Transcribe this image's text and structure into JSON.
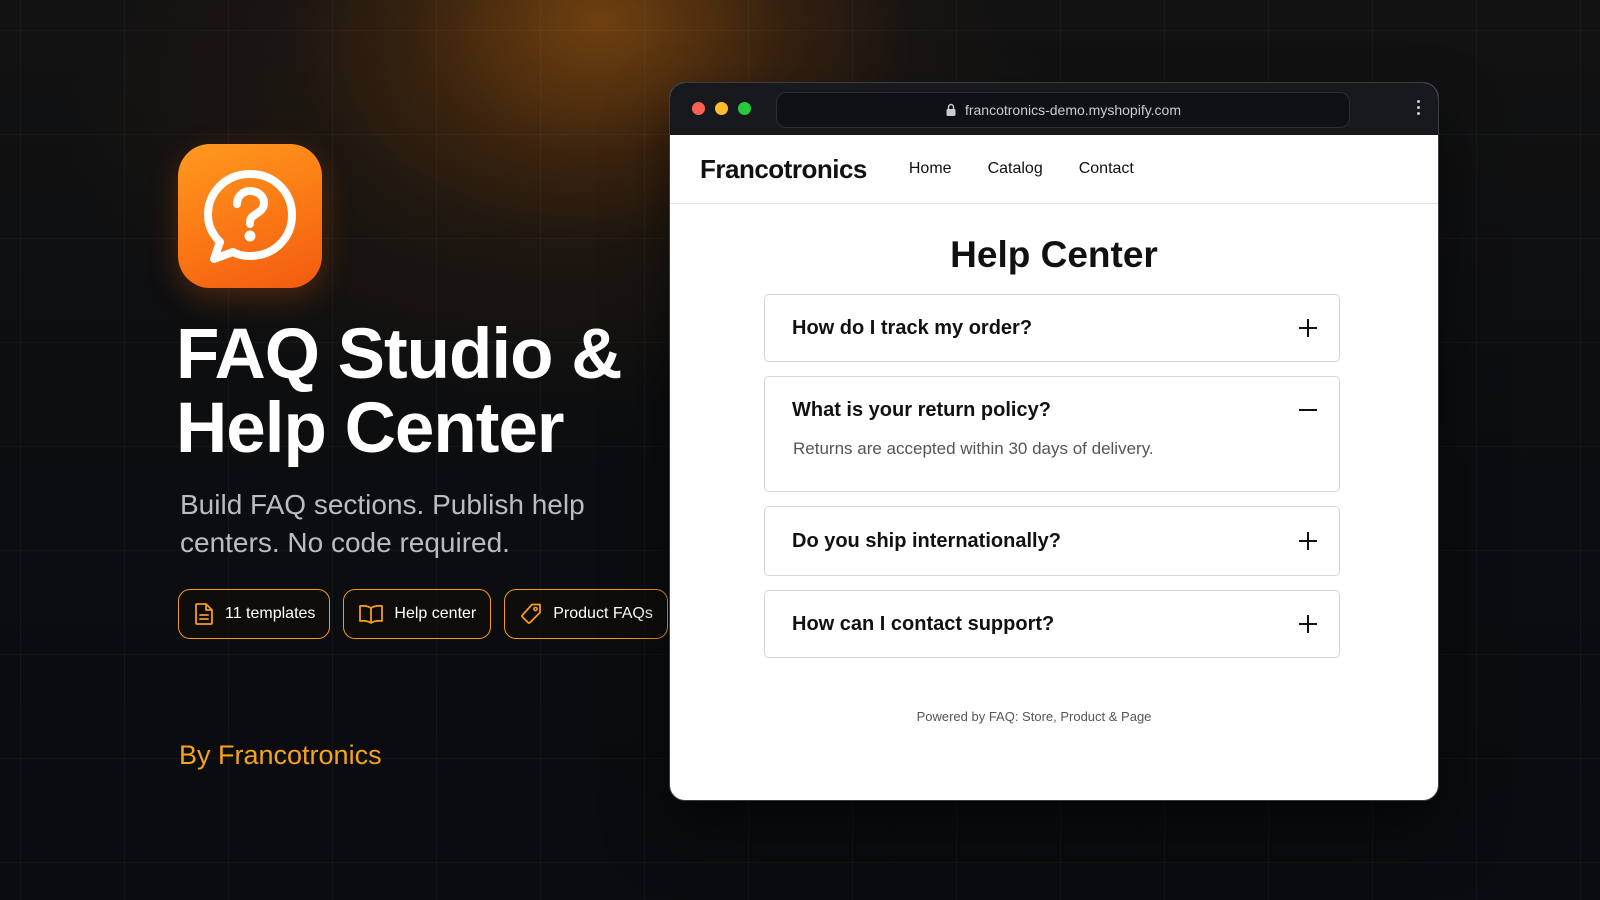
{
  "hero": {
    "title": "FAQ Studio & Help Center",
    "subtitle": "Build FAQ sections. Publish help centers. No code required.",
    "pills": [
      {
        "label": "11 templates",
        "icon": "document-icon"
      },
      {
        "label": "Help center",
        "icon": "book-icon"
      },
      {
        "label": "Product FAQs",
        "icon": "tag-icon"
      }
    ],
    "byline": "By Francotronics"
  },
  "browser": {
    "url": "francotronics-demo.myshopify.com"
  },
  "site": {
    "brand": "Francotronics",
    "nav": [
      "Home",
      "Catalog",
      "Contact"
    ],
    "title": "Help Center",
    "faqs": [
      {
        "question": "How do I track my order?",
        "expanded": false,
        "answer": ""
      },
      {
        "question": "What is your return policy?",
        "expanded": true,
        "answer": "Returns are accepted within 30 days of delivery."
      },
      {
        "question": "Do you ship internationally?",
        "expanded": false,
        "answer": ""
      },
      {
        "question": "How can I contact support?",
        "expanded": false,
        "answer": ""
      }
    ],
    "powered_by": "Powered by FAQ: Store, Product & Page"
  },
  "colors": {
    "accent": "#f59a1c",
    "icon_gradient_top": "#ff9a1f",
    "icon_gradient_bottom": "#f35a10"
  }
}
